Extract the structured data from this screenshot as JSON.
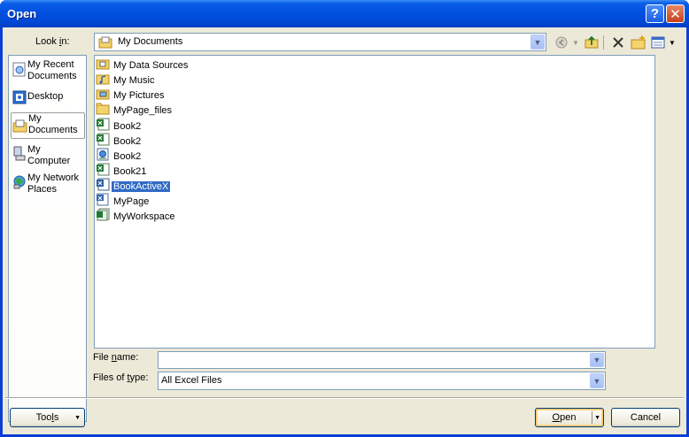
{
  "window": {
    "title": "Open"
  },
  "look_in": {
    "label_pre": "Look ",
    "label_u": "i",
    "label_post": "n:",
    "value": "My Documents"
  },
  "places": [
    {
      "label1": "My Recent",
      "label2": "Documents",
      "icon": "recent-documents-icon"
    },
    {
      "label1": "Desktop",
      "label2": "",
      "icon": "desktop-icon"
    },
    {
      "label1": "My",
      "label2": "Documents",
      "icon": "my-documents-icon"
    },
    {
      "label1": "My",
      "label2": "Computer",
      "icon": "my-computer-icon"
    },
    {
      "label1": "My Network",
      "label2": "Places",
      "icon": "network-places-icon"
    }
  ],
  "files": [
    {
      "name": "My Data Sources",
      "icon": "data-sources-folder-icon"
    },
    {
      "name": "My Music",
      "icon": "music-folder-icon"
    },
    {
      "name": "My Pictures",
      "icon": "pictures-folder-icon"
    },
    {
      "name": "MyPage_files",
      "icon": "folder-icon"
    },
    {
      "name": "Book2",
      "icon": "excel-workbook-icon"
    },
    {
      "name": "Book2",
      "icon": "excel-workbook-icon"
    },
    {
      "name": "Book2",
      "icon": "web-page-icon"
    },
    {
      "name": "Book21",
      "icon": "excel-workbook-icon"
    },
    {
      "name": "BookActiveX",
      "icon": "excel-workbook-icon"
    },
    {
      "name": "MyPage",
      "icon": "web-page-icon"
    },
    {
      "name": "MyWorkspace",
      "icon": "excel-workspace-icon"
    }
  ],
  "selected_file": "BookActiveX",
  "file_name": {
    "label_pre": "File ",
    "label_u": "n",
    "label_post": "ame:",
    "value": ""
  },
  "file_type": {
    "label_pre": "Files of ",
    "label_u": "t",
    "label_post": "ype:",
    "value": "All Excel Files"
  },
  "buttons": {
    "tools_pre": "Too",
    "tools_u": "l",
    "tools_post": "s",
    "open_u": "O",
    "open_post": "pen",
    "cancel": "Cancel"
  },
  "toolbar_icons": [
    "back-icon",
    "up-one-level-icon",
    "delete-icon",
    "new-folder-icon",
    "views-icon"
  ]
}
